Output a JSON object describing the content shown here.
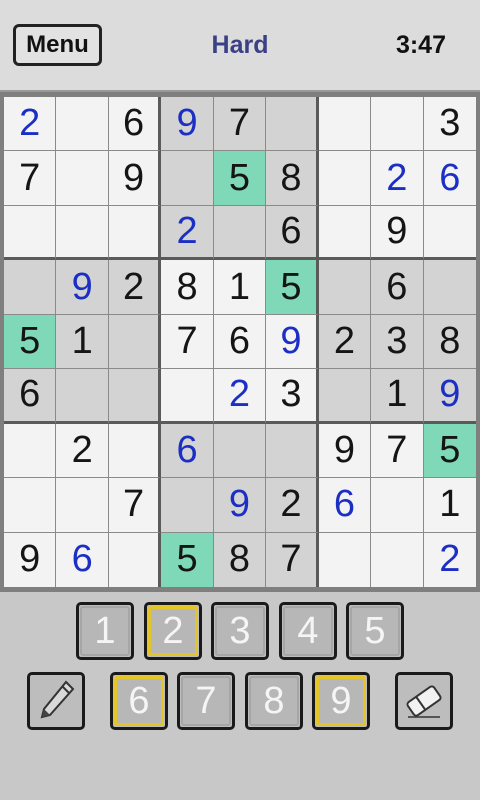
{
  "header": {
    "menu_label": "Menu",
    "difficulty": "Hard",
    "timer": "3:47"
  },
  "board": {
    "cells": [
      [
        {
          "v": "2",
          "t": "user"
        },
        {
          "v": "",
          "t": ""
        },
        {
          "v": "6",
          "t": "given"
        },
        {
          "v": "9",
          "t": "user"
        },
        {
          "v": "7",
          "t": "given"
        },
        {
          "v": "",
          "t": ""
        },
        {
          "v": "",
          "t": ""
        },
        {
          "v": "",
          "t": ""
        },
        {
          "v": "3",
          "t": "given"
        }
      ],
      [
        {
          "v": "7",
          "t": "given"
        },
        {
          "v": "",
          "t": ""
        },
        {
          "v": "9",
          "t": "given"
        },
        {
          "v": "",
          "t": ""
        },
        {
          "v": "5",
          "t": "given",
          "hl": true
        },
        {
          "v": "8",
          "t": "given"
        },
        {
          "v": "",
          "t": ""
        },
        {
          "v": "2",
          "t": "user"
        },
        {
          "v": "6",
          "t": "user"
        }
      ],
      [
        {
          "v": "",
          "t": ""
        },
        {
          "v": "",
          "t": ""
        },
        {
          "v": "",
          "t": ""
        },
        {
          "v": "2",
          "t": "user"
        },
        {
          "v": "",
          "t": ""
        },
        {
          "v": "6",
          "t": "given"
        },
        {
          "v": "",
          "t": ""
        },
        {
          "v": "9",
          "t": "given"
        },
        {
          "v": "",
          "t": ""
        }
      ],
      [
        {
          "v": "",
          "t": ""
        },
        {
          "v": "9",
          "t": "user"
        },
        {
          "v": "2",
          "t": "given"
        },
        {
          "v": "8",
          "t": "given"
        },
        {
          "v": "1",
          "t": "given"
        },
        {
          "v": "5",
          "t": "given",
          "hl": true
        },
        {
          "v": "",
          "t": ""
        },
        {
          "v": "6",
          "t": "given"
        },
        {
          "v": "",
          "t": ""
        }
      ],
      [
        {
          "v": "5",
          "t": "given",
          "hl": true
        },
        {
          "v": "1",
          "t": "given"
        },
        {
          "v": "",
          "t": ""
        },
        {
          "v": "7",
          "t": "given"
        },
        {
          "v": "6",
          "t": "given"
        },
        {
          "v": "9",
          "t": "user"
        },
        {
          "v": "2",
          "t": "given"
        },
        {
          "v": "3",
          "t": "given"
        },
        {
          "v": "8",
          "t": "given"
        }
      ],
      [
        {
          "v": "6",
          "t": "given"
        },
        {
          "v": "",
          "t": ""
        },
        {
          "v": "",
          "t": ""
        },
        {
          "v": "",
          "t": ""
        },
        {
          "v": "2",
          "t": "user"
        },
        {
          "v": "3",
          "t": "given"
        },
        {
          "v": "",
          "t": ""
        },
        {
          "v": "1",
          "t": "given"
        },
        {
          "v": "9",
          "t": "user"
        }
      ],
      [
        {
          "v": "",
          "t": ""
        },
        {
          "v": "2",
          "t": "given"
        },
        {
          "v": "",
          "t": ""
        },
        {
          "v": "6",
          "t": "user"
        },
        {
          "v": "",
          "t": ""
        },
        {
          "v": "",
          "t": ""
        },
        {
          "v": "9",
          "t": "given"
        },
        {
          "v": "7",
          "t": "given"
        },
        {
          "v": "5",
          "t": "given",
          "hl": true
        }
      ],
      [
        {
          "v": "",
          "t": ""
        },
        {
          "v": "",
          "t": ""
        },
        {
          "v": "7",
          "t": "given"
        },
        {
          "v": "",
          "t": ""
        },
        {
          "v": "9",
          "t": "user"
        },
        {
          "v": "2",
          "t": "given"
        },
        {
          "v": "6",
          "t": "user"
        },
        {
          "v": "",
          "t": ""
        },
        {
          "v": "1",
          "t": "given"
        }
      ],
      [
        {
          "v": "9",
          "t": "given"
        },
        {
          "v": "6",
          "t": "user"
        },
        {
          "v": "",
          "t": ""
        },
        {
          "v": "5",
          "t": "given",
          "hl": true
        },
        {
          "v": "8",
          "t": "given"
        },
        {
          "v": "7",
          "t": "given"
        },
        {
          "v": "",
          "t": ""
        },
        {
          "v": "",
          "t": ""
        },
        {
          "v": "2",
          "t": "user"
        }
      ]
    ]
  },
  "keypad": {
    "keys": [
      {
        "label": "1",
        "selected": false
      },
      {
        "label": "2",
        "selected": true
      },
      {
        "label": "3",
        "selected": false
      },
      {
        "label": "4",
        "selected": false
      },
      {
        "label": "5",
        "selected": false
      },
      {
        "label": "6",
        "selected": true
      },
      {
        "label": "7",
        "selected": false
      },
      {
        "label": "8",
        "selected": false
      },
      {
        "label": "9",
        "selected": true
      }
    ],
    "tools": [
      {
        "icon": "pencil-icon"
      },
      {
        "icon": "eraser-icon"
      }
    ]
  },
  "colors": {
    "given_digit": "#151515",
    "user_digit": "#1c2fc4",
    "highlight": "#7fd9b8",
    "selected_key_border": "#e3c52a",
    "difficulty_text": "#3b3f86"
  }
}
